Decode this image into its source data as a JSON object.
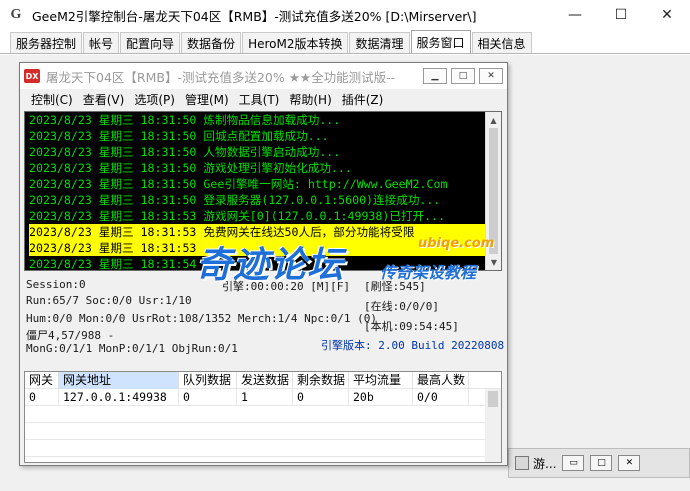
{
  "outer": {
    "icon": "G",
    "title": "GeeM2引擎控制台-屠龙天下04区【RMB】-测试充值多送20% [D:\\Mirserver\\]",
    "minimize": "—",
    "maximize": "☐",
    "close": "✕",
    "tabs": [
      {
        "label": "服务器控制"
      },
      {
        "label": "帐号"
      },
      {
        "label": "配置向导"
      },
      {
        "label": "数据备份"
      },
      {
        "label": "HeroM2版本转换"
      },
      {
        "label": "数据清理"
      },
      {
        "label": "服务窗口"
      },
      {
        "label": "相关信息"
      }
    ],
    "active_tab": 6,
    "minimized_window": {
      "title": "游..."
    }
  },
  "inner": {
    "icon_text": "DX",
    "title": "屠龙天下04区【RMB】-测试充值多送20% ★★全功能测试版--",
    "menu": [
      {
        "label": "控制(C)"
      },
      {
        "label": "查看(V)"
      },
      {
        "label": "选项(P)"
      },
      {
        "label": "管理(M)"
      },
      {
        "label": "工具(T)"
      },
      {
        "label": "帮助(H)"
      },
      {
        "label": "插件(Z)"
      }
    ],
    "log": [
      {
        "text": "2023/8/23 星期三 18:31:50 炼制物品信息加载成功...",
        "highlight": false
      },
      {
        "text": "2023/8/23 星期三 18:31:50 回城点配置加载成功...",
        "highlight": false
      },
      {
        "text": "2023/8/23 星期三 18:31:50 人物数据引擎启动成功...",
        "highlight": false
      },
      {
        "text": "2023/8/23 星期三 18:31:50 游戏处理引擎初始化成功...",
        "highlight": false
      },
      {
        "text": "2023/8/23 星期三 18:31:50 Gee引擎唯一网站: http://Www.GeeM2.Com",
        "highlight": false
      },
      {
        "text": "2023/8/23 星期三 18:31:50 登录服务器(127.0.0.1:5600)连接成功...",
        "highlight": false
      },
      {
        "text": "2023/8/23 星期三 18:31:53 游戏网关[0](127.0.0.1:49938)已打开...",
        "highlight": false
      },
      {
        "text": "2023/8/23 星期三 18:31:53 免费网关在线达50人后，部分功能将受限",
        "highlight": true
      },
      {
        "text": "2023/8/23 星期三 18:31:53",
        "highlight": true
      },
      {
        "text": "2023/8/23 星期三 18:31:54",
        "highlight": false
      }
    ],
    "stats": {
      "session": "Session:0",
      "engine": "引擎:00:00:20 [M][F]",
      "refresh": "[刷怪:545]",
      "run": "Run:65/7 Soc:0/0 Usr:1/10",
      "online": "[在线:0/0/0]",
      "hum": "Hum:0/0 Mon:0/0 UsrRot:108/1352 Merch:1/4 Npc:0/1 (0)",
      "local": "[本机:09:54:45]",
      "corpse": "僵尸4,57/988 -",
      "mong": "MonG:0/1/1 MonP:0/1/1 ObjRun:0/1",
      "version": "引擎版本: 2.00 Build 20220808"
    },
    "table": {
      "columns": [
        "网关",
        "网关地址",
        "队列数据",
        "发送数据",
        "剩余数据",
        "平均流量",
        "最高人数"
      ],
      "rows": [
        [
          "0",
          "127.0.0.1:49938",
          "0",
          "1",
          "0",
          "20b",
          "0/0"
        ]
      ]
    }
  },
  "watermark": {
    "main": "奇迹论坛",
    "sub": "传奇架设教程",
    "url": "ubiqe.com"
  },
  "colors": {
    "log_bg": "#000000",
    "log_text": "#00e000",
    "log_highlight": "#ffff00",
    "stats_blue": "#0033aa",
    "watermark_blue": "#1e6fd8"
  }
}
